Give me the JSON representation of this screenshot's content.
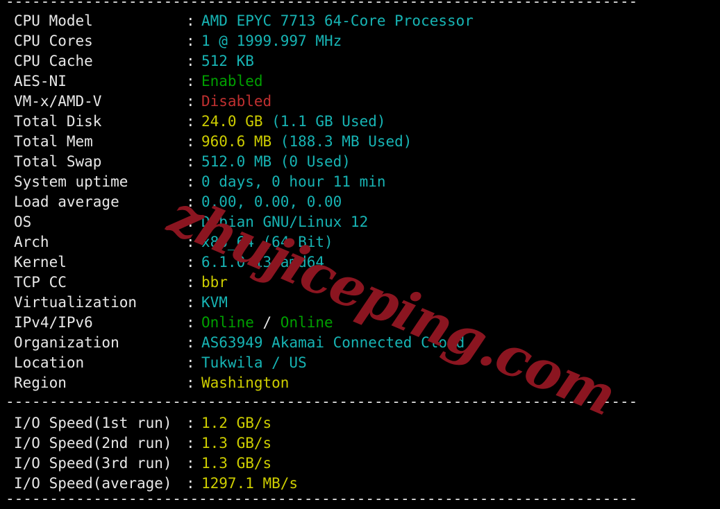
{
  "terminal": {
    "background": "#000000",
    "colors": {
      "white": "#e8e8e8",
      "cyan": "#17b4b4",
      "yellow": "#cdcd00",
      "green": "#00a000",
      "red": "#c03030",
      "watermark": "#8b1520"
    },
    "separator": "--------------------------------------------------------------------------",
    "colon": ":"
  },
  "watermark": {
    "text": "zhujiceping.com"
  },
  "system_info": {
    "rows": [
      {
        "label": "CPU Model",
        "parts": [
          {
            "text": "AMD EPYC 7713 64-Core Processor",
            "color": "cyan"
          }
        ]
      },
      {
        "label": "CPU Cores",
        "parts": [
          {
            "text": "1 @ 1999.997 MHz",
            "color": "cyan"
          }
        ]
      },
      {
        "label": "CPU Cache",
        "parts": [
          {
            "text": "512 KB",
            "color": "cyan"
          }
        ]
      },
      {
        "label": "AES-NI",
        "parts": [
          {
            "text": "Enabled",
            "color": "green"
          }
        ]
      },
      {
        "label": "VM-x/AMD-V",
        "parts": [
          {
            "text": "Disabled",
            "color": "red"
          }
        ]
      },
      {
        "label": "Total Disk",
        "parts": [
          {
            "text": "24.0 GB ",
            "color": "yellow"
          },
          {
            "text": "(1.1 GB Used)",
            "color": "cyan"
          }
        ]
      },
      {
        "label": "Total Mem",
        "parts": [
          {
            "text": "960.6 MB ",
            "color": "yellow"
          },
          {
            "text": "(188.3 MB Used)",
            "color": "cyan"
          }
        ]
      },
      {
        "label": "Total Swap",
        "parts": [
          {
            "text": "512.0 MB (0 Used)",
            "color": "cyan"
          }
        ]
      },
      {
        "label": "System uptime",
        "parts": [
          {
            "text": "0 days, 0 hour 11 min",
            "color": "cyan"
          }
        ]
      },
      {
        "label": "Load average",
        "parts": [
          {
            "text": "0.00, 0.00, 0.00",
            "color": "cyan"
          }
        ]
      },
      {
        "label": "OS",
        "parts": [
          {
            "text": "Debian GNU/Linux 12",
            "color": "cyan"
          }
        ]
      },
      {
        "label": "Arch",
        "parts": [
          {
            "text": "x86_64 (64 Bit)",
            "color": "cyan"
          }
        ]
      },
      {
        "label": "Kernel",
        "parts": [
          {
            "text": "6.1.0-13-amd64",
            "color": "cyan"
          }
        ]
      },
      {
        "label": "TCP CC",
        "parts": [
          {
            "text": "bbr",
            "color": "yellow"
          }
        ]
      },
      {
        "label": "Virtualization",
        "parts": [
          {
            "text": "KVM",
            "color": "cyan"
          }
        ]
      },
      {
        "label": "IPv4/IPv6",
        "parts": [
          {
            "text": "Online",
            "color": "green"
          },
          {
            "text": " / ",
            "color": "white"
          },
          {
            "text": "Online",
            "color": "green"
          }
        ]
      },
      {
        "label": "Organization",
        "parts": [
          {
            "text": "AS63949 Akamai Connected Cloud",
            "color": "cyan"
          }
        ]
      },
      {
        "label": "Location",
        "parts": [
          {
            "text": "Tukwila / US",
            "color": "cyan"
          }
        ]
      },
      {
        "label": "Region",
        "parts": [
          {
            "text": "Washington",
            "color": "yellow"
          }
        ]
      }
    ]
  },
  "io_speed": {
    "rows": [
      {
        "label": "I/O Speed(1st run)",
        "parts": [
          {
            "text": "1.2 GB/s",
            "color": "yellow"
          }
        ]
      },
      {
        "label": "I/O Speed(2nd run)",
        "parts": [
          {
            "text": "1.3 GB/s",
            "color": "yellow"
          }
        ]
      },
      {
        "label": "I/O Speed(3rd run)",
        "parts": [
          {
            "text": "1.3 GB/s",
            "color": "yellow"
          }
        ]
      },
      {
        "label": "I/O Speed(average)",
        "parts": [
          {
            "text": "1297.1 MB/s",
            "color": "yellow"
          }
        ]
      }
    ]
  }
}
